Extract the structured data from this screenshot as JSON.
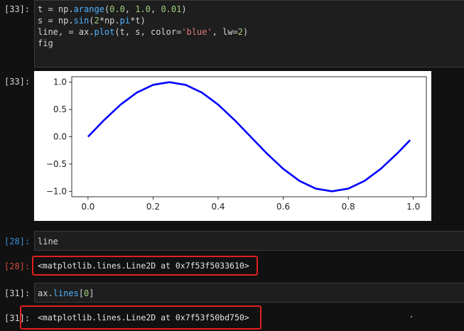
{
  "cells": [
    {
      "prompt": "[33]:",
      "code": [
        [
          [
            "t = np.",
            "op"
          ],
          [
            "arange",
            "attr"
          ],
          [
            "(",
            "op"
          ],
          [
            "0.0",
            "num"
          ],
          [
            ", ",
            "op"
          ],
          [
            "1.0",
            "num"
          ],
          [
            ", ",
            "op"
          ],
          [
            "0.01",
            "num"
          ],
          [
            ")",
            "op"
          ]
        ],
        [
          [
            "s = np.",
            "op"
          ],
          [
            "sin",
            "attr"
          ],
          [
            "(",
            "op"
          ],
          [
            "2",
            "num"
          ],
          [
            "*np.",
            "op"
          ],
          [
            "pi",
            "attr"
          ],
          [
            "*t)",
            "op"
          ]
        ],
        [
          [
            "line, = ax.",
            "op"
          ],
          [
            "plot",
            "attr"
          ],
          [
            "(t, s, color=",
            "op"
          ],
          [
            "'blue'",
            "str"
          ],
          [
            ", lw=",
            "op"
          ],
          [
            "2",
            "num"
          ],
          [
            ")",
            "op"
          ]
        ],
        [
          [
            "fig",
            "op"
          ]
        ]
      ]
    },
    {
      "prompt": "[28]:",
      "code": [
        [
          [
            "line",
            "op"
          ]
        ]
      ]
    },
    {
      "prompt": "[31]:",
      "code": [
        [
          [
            "ax.",
            "op"
          ],
          [
            "lines",
            "attr"
          ],
          [
            "[",
            "op"
          ],
          [
            "0",
            "num"
          ],
          [
            "]",
            "op"
          ]
        ]
      ]
    }
  ],
  "outputs": {
    "plot_prompt": "[33]:",
    "out28_prompt": "[28]:",
    "out28_text": "<matplotlib.lines.Line2D at 0x7f53f5033610>",
    "out31_prompt": "[31]:",
    "out31_text": "<matplotlib.lines.Line2D at 0x7f53f50bd750>"
  },
  "chart_data": {
    "type": "line",
    "title": "",
    "xlabel": "",
    "ylabel": "",
    "xlim": [
      -0.05,
      1.04
    ],
    "ylim": [
      -1.1,
      1.1
    ],
    "x_ticks": [
      0.0,
      0.2,
      0.4,
      0.6,
      0.8,
      1.0
    ],
    "x_tick_labels": [
      "0.0",
      "0.2",
      "0.4",
      "0.6",
      "0.8",
      "1.0"
    ],
    "y_ticks": [
      -1.0,
      -0.5,
      0.0,
      0.5,
      1.0
    ],
    "y_tick_labels": [
      "−1.0",
      "−0.5",
      "0.0",
      "0.5",
      "1.0"
    ],
    "grid": false,
    "series": [
      {
        "color": "#0000ff",
        "x": [
          0.0,
          0.05,
          0.1,
          0.15,
          0.2,
          0.25,
          0.3,
          0.35,
          0.4,
          0.45,
          0.5,
          0.55,
          0.6,
          0.65,
          0.7,
          0.75,
          0.8,
          0.85,
          0.9,
          0.95,
          0.99
        ],
        "y": [
          0.0,
          0.309,
          0.588,
          0.809,
          0.951,
          1.0,
          0.951,
          0.809,
          0.588,
          0.309,
          0.0,
          -0.309,
          -0.588,
          -0.809,
          -0.951,
          -1.0,
          -0.951,
          -0.809,
          -0.588,
          -0.309,
          -0.063
        ]
      }
    ]
  },
  "colors": {
    "background": "#111111",
    "cell_bg": "#1e1e1e",
    "highlight_box": "#e02020",
    "number_token": "#9fcf7a",
    "attr_token": "#4fb2ff",
    "string_token": "#e0787a"
  }
}
